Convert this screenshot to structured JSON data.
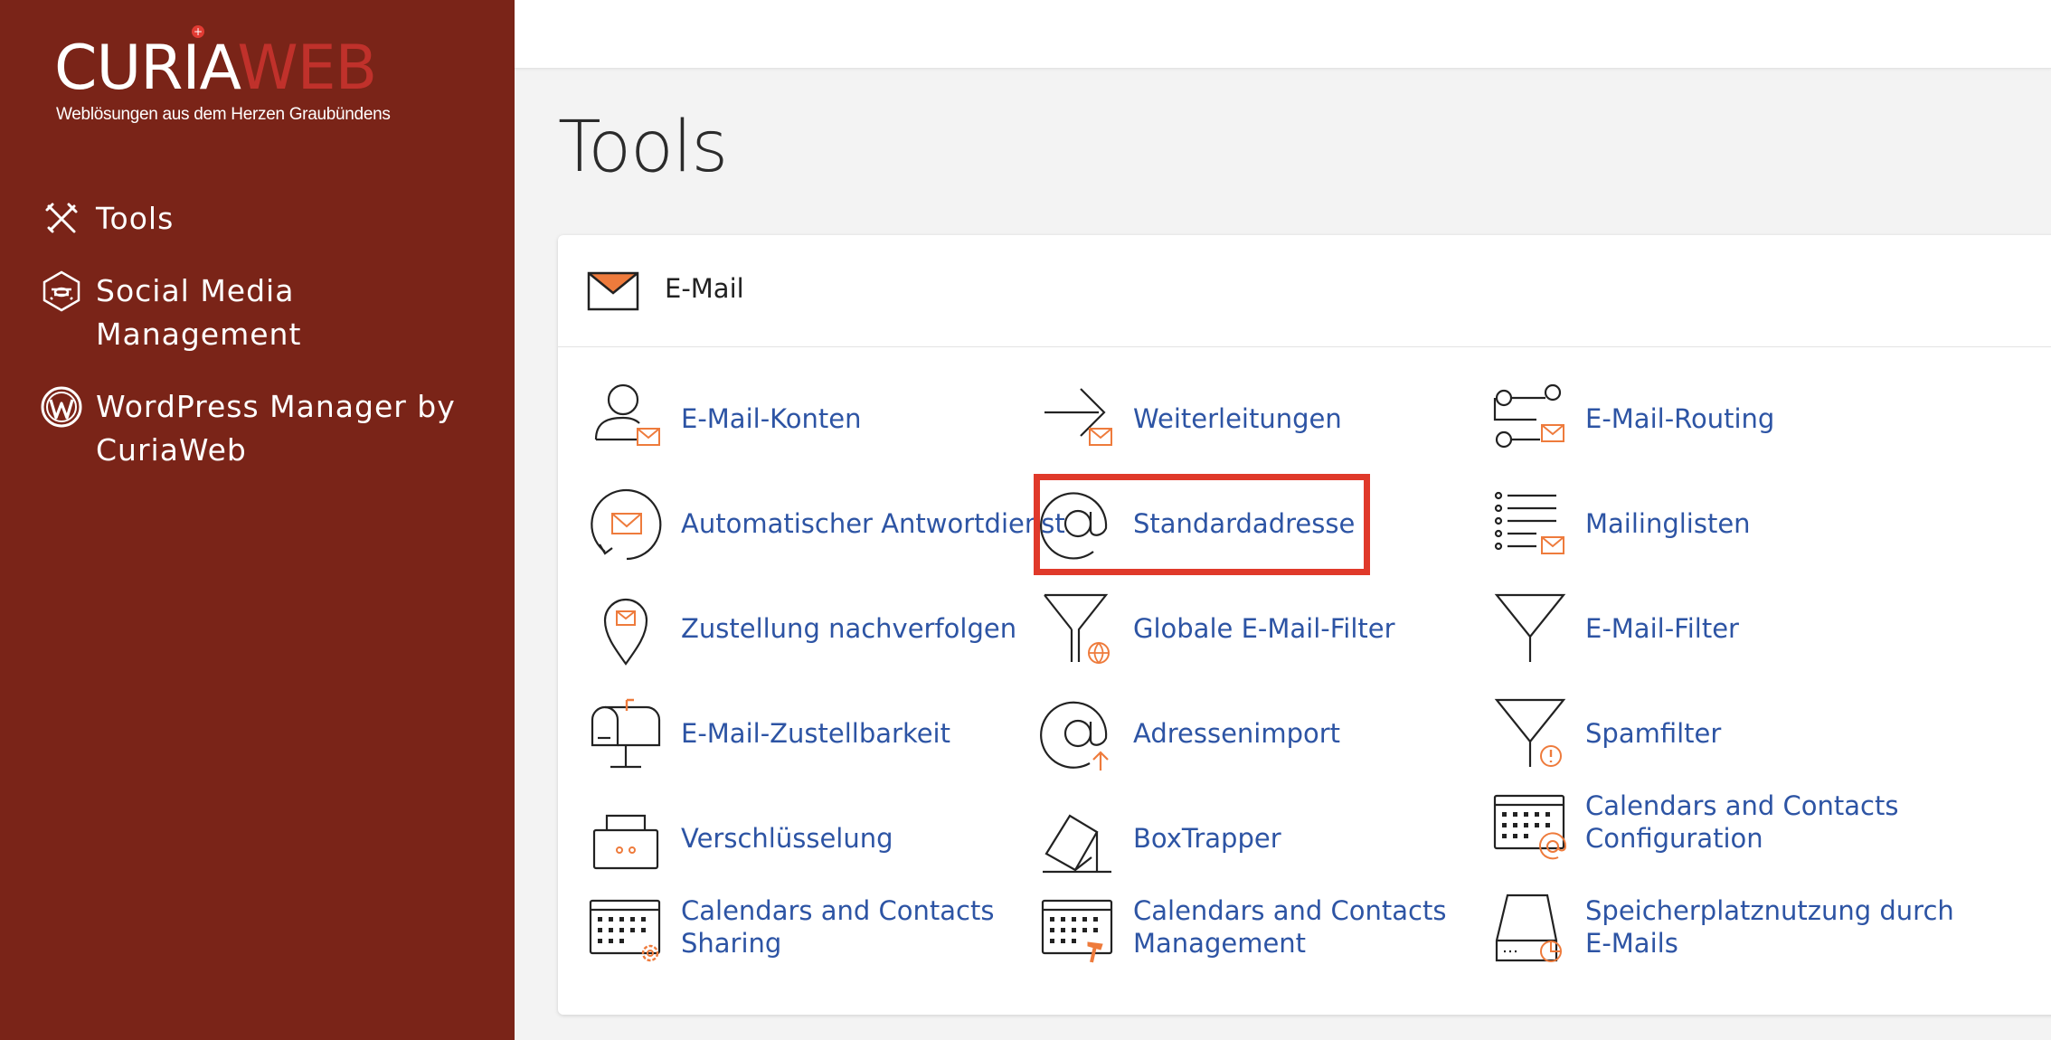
{
  "brand": {
    "name_part1": "CURIA",
    "name_part2": "WEB",
    "tagline": "Weblösungen aus dem Herzen Graubündens",
    "star": "+"
  },
  "sidebar": {
    "items": [
      {
        "label_line1": "Tools",
        "label_line2": ""
      },
      {
        "label_line1": "Social Media",
        "label_line2": "Management"
      },
      {
        "label_line1": "WordPress Manager by",
        "label_line2": "CuriaWeb"
      }
    ]
  },
  "page": {
    "title": "Tools"
  },
  "email_section": {
    "title": "E-Mail",
    "tools": [
      {
        "line1": "E-Mail-Konten",
        "line2": ""
      },
      {
        "line1": "Weiterleitungen",
        "line2": ""
      },
      {
        "line1": "E-Mail-Routing",
        "line2": ""
      },
      {
        "line1": "Automatischer Antwortdienst",
        "line2": ""
      },
      {
        "line1": "Standardadresse",
        "line2": ""
      },
      {
        "line1": "Mailinglisten",
        "line2": ""
      },
      {
        "line1": "Zustellung nachverfolgen",
        "line2": ""
      },
      {
        "line1": "Globale E-Mail-Filter",
        "line2": ""
      },
      {
        "line1": "E-Mail-Filter",
        "line2": ""
      },
      {
        "line1": "E-Mail-Zustellbarkeit",
        "line2": ""
      },
      {
        "line1": "Adressenimport",
        "line2": ""
      },
      {
        "line1": "Spamfilter",
        "line2": ""
      },
      {
        "line1": "Verschlüsselung",
        "line2": ""
      },
      {
        "line1": "BoxTrapper",
        "line2": ""
      },
      {
        "line1": "Calendars and Contacts",
        "line2": "Configuration"
      },
      {
        "line1": "Calendars and Contacts",
        "line2": "Sharing"
      },
      {
        "line1": "Calendars and Contacts",
        "line2": "Management"
      },
      {
        "line1": "Speicherplatznutzung durch",
        "line2": "E-Mails"
      }
    ]
  },
  "colors": {
    "sidebar_bg": "#7a2418",
    "link": "#2d54a4",
    "accent_orange": "#ee7b3c",
    "highlight_red": "#e0392a"
  }
}
